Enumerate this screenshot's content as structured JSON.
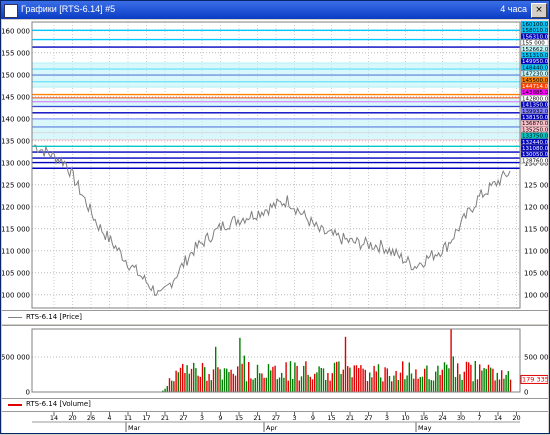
{
  "window": {
    "title": "Графики [RTS-6.14] #5",
    "period": "4 часа",
    "close_glyph": "×"
  },
  "colors": {
    "titlebar": "#0a3cc4",
    "up": "#008000",
    "down": "#e00000",
    "price_line": "#808080",
    "level_band": "#c0f4f8"
  },
  "price_panel": {
    "legend": "RTS-6.14 [Price]",
    "y_ticks": [
      "160 000",
      "155 000",
      "150 000",
      "145 000",
      "140 000",
      "135 000",
      "130 000",
      "125 000",
      "120 000",
      "115 000",
      "110 000",
      "105 000",
      "100 000"
    ],
    "level_labels": [
      {
        "text": "160100.0",
        "bg": "#00c8ff"
      },
      {
        "text": "158010.0",
        "bg": "#00c8ff"
      },
      {
        "text": "156310.0",
        "bg": "#0000c0"
      },
      {
        "text": "155 000",
        "bg": "#ffffff"
      },
      {
        "text": "152662.0",
        "bg": "#c0f4f8"
      },
      {
        "text": "151310.0",
        "bg": "#00c8ff"
      },
      {
        "text": "149950.0",
        "bg": "#0000c0"
      },
      {
        "text": "148440.0",
        "bg": "#00c8ff"
      },
      {
        "text": "147230.0",
        "bg": "#c0f4f8"
      },
      {
        "text": "145500.0",
        "bg": "#ff8000"
      },
      {
        "text": "144714.0",
        "bg": "#ff4000"
      },
      {
        "text": "143885.0",
        "bg": "#ff00ff"
      },
      {
        "text": "142800.0",
        "bg": "#ffffff"
      },
      {
        "text": "141350.0",
        "bg": "#0000c0"
      },
      {
        "text": "139932.0",
        "bg": "#8080ff"
      },
      {
        "text": "138150.0",
        "bg": "#0000c0"
      },
      {
        "text": "136870.0",
        "bg": "#ffc0cb"
      },
      {
        "text": "135250.0",
        "bg": "#ffc0cb"
      },
      {
        "text": "133750.0",
        "bg": "#00c8c8"
      },
      {
        "text": "132440.0",
        "bg": "#0000c0"
      },
      {
        "text": "131080.0",
        "bg": "#0000c0"
      },
      {
        "text": "130050.0",
        "bg": "#0000c0"
      },
      {
        "text": "128760.0",
        "bg": "#ffffff"
      }
    ]
  },
  "volume_panel": {
    "legend": "RTS-6.14 [Volume]",
    "y_ticks": [
      "500 000",
      "0"
    ],
    "last_value": "179 335"
  },
  "x_axis": {
    "day_ticks": [
      "14",
      "20",
      "26",
      "4",
      "11",
      "17",
      "21",
      "27",
      "3",
      "9",
      "15",
      "21",
      "27",
      "3",
      "9",
      "15",
      "21",
      "27",
      "3",
      "10",
      "16",
      "24",
      "30",
      "7",
      "14",
      "20"
    ],
    "month_labels": [
      "Mar",
      "Apr",
      "May"
    ]
  },
  "chart_data": [
    {
      "type": "line",
      "title": "RTS-6.14 [Price]",
      "x": [
        "start",
        "26 Feb",
        "4 Mar",
        "11 Mar",
        "15 Mar",
        "17 Mar",
        "27 Mar",
        "3 Apr",
        "9 Apr",
        "15 Apr",
        "21 Apr",
        "27 Apr",
        "3 May",
        "7 May",
        "14 May",
        "20 May"
      ],
      "y": [
        134000,
        130000,
        116000,
        107000,
        99500,
        110000,
        116000,
        118500,
        121500,
        114500,
        112000,
        111000,
        106500,
        111000,
        122000,
        128000
      ],
      "ylim": [
        97000,
        162000
      ],
      "series": [
        {
          "name": "RTS-6.14 [Price]"
        }
      ],
      "horizontal_levels": [
        160100,
        158010,
        156310,
        152662,
        151310,
        149950,
        148440,
        147230,
        145500,
        144714,
        143885,
        142800,
        141350,
        139932,
        138150,
        136870,
        135250,
        133750,
        132440,
        131080,
        130050,
        128760
      ],
      "grid": true
    },
    {
      "type": "bar",
      "title": "RTS-6.14 [Volume]",
      "series": [
        {
          "name": "RTS-6.14 [Volume]"
        }
      ],
      "x_range": [
        "start",
        "20 May"
      ],
      "typical_range": [
        150000,
        450000
      ],
      "max": 900000,
      "last": 179335,
      "ylim": [
        0,
        900000
      ]
    }
  ]
}
